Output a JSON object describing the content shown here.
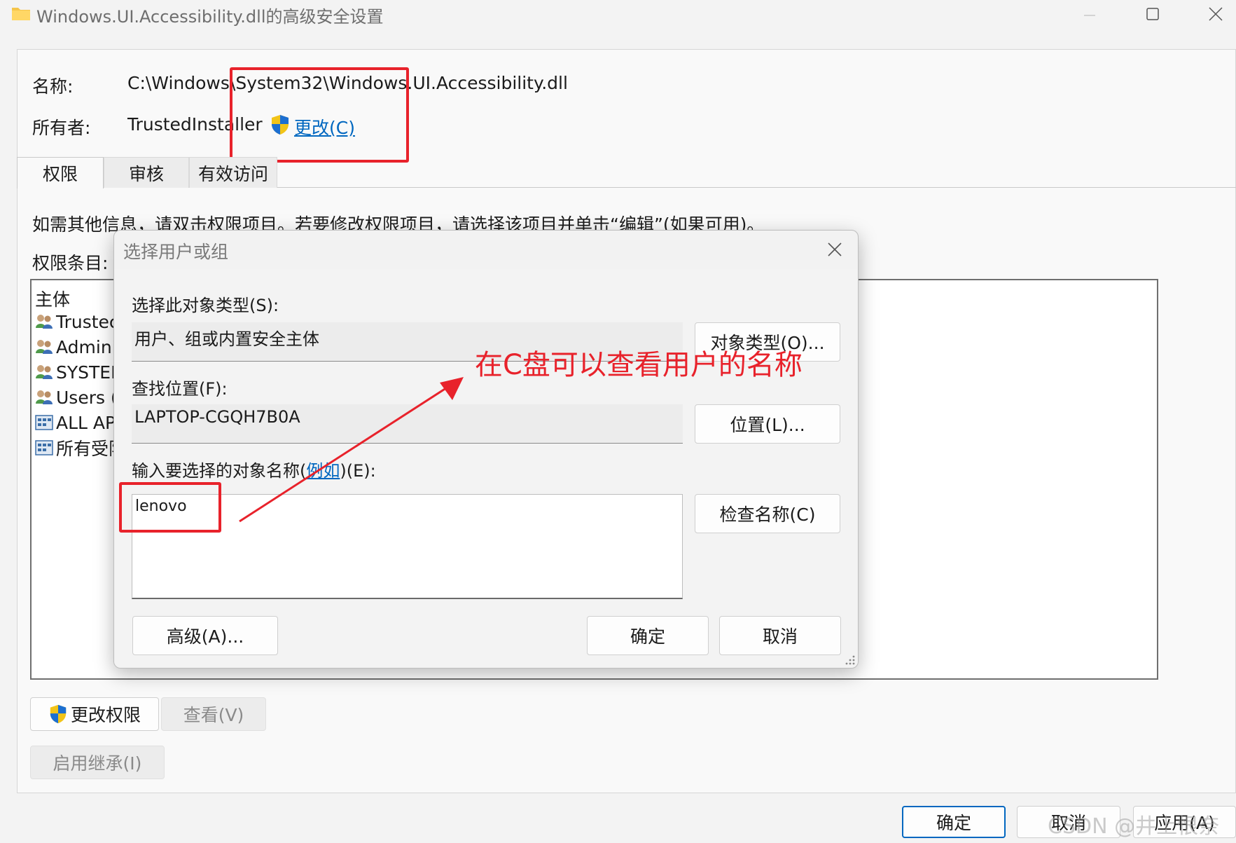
{
  "window": {
    "title": "Windows.UI.Accessibility.dll的高级安全设置"
  },
  "fields": {
    "name_label": "名称:",
    "name_value": "C:\\Windows\\System32\\Windows.UI.Accessibility.dll",
    "owner_label": "所有者:",
    "owner_value": "TrustedInstaller",
    "change_owner_link": "更改(C)"
  },
  "tabs": [
    {
      "label": "权限",
      "active": true
    },
    {
      "label": "审核",
      "active": false
    },
    {
      "label": "有效访问",
      "active": false
    }
  ],
  "info_text": "如需其他信息，请双击权限项目。若要修改权限项目，请选择该项目并单击“编辑”(如果可用)。",
  "permission_entries_label": "权限条目:",
  "permission_list": {
    "column_principal": "主体",
    "rows": [
      {
        "principal": "Trustec",
        "icon": "user-group-icon"
      },
      {
        "principal": "Admini",
        "icon": "user-group-icon"
      },
      {
        "principal": "SYSTEN",
        "icon": "user-group-icon"
      },
      {
        "principal": "Users (",
        "icon": "user-group-icon"
      },
      {
        "principal": "ALL AP",
        "icon": "app-package-icon"
      },
      {
        "principal": "所有受限",
        "icon": "app-package-icon"
      }
    ]
  },
  "buttons": {
    "change_permissions": "更改权限",
    "view": "查看(V)",
    "enable_inheritance": "启用继承(I)",
    "ok": "确定",
    "cancel": "取消",
    "apply": "应用(A)"
  },
  "dialog": {
    "title": "选择用户或组",
    "object_type_label": "选择此对象类型(S):",
    "object_type_value": "用户、组或内置安全主体",
    "object_type_button": "对象类型(O)...",
    "location_label": "查找位置(F):",
    "location_value": "LAPTOP-CGQH7B0A",
    "location_button": "位置(L)...",
    "object_name_label_prefix": "输入要选择的对象名称(",
    "example_link": "例如",
    "object_name_label_suffix": ")(E):",
    "object_name_value": "lenovo",
    "check_names_button": "检查名称(C)",
    "advanced_button": "高级(A)...",
    "ok_button": "确定",
    "cancel_button": "取消"
  },
  "annotation": {
    "text": "在C盘可以查看用户的名称",
    "color": "#e8222b"
  },
  "watermark": "CSDN @井上恨奈",
  "colors": {
    "accent": "#0067c0",
    "annotation_red": "#e8222b"
  }
}
